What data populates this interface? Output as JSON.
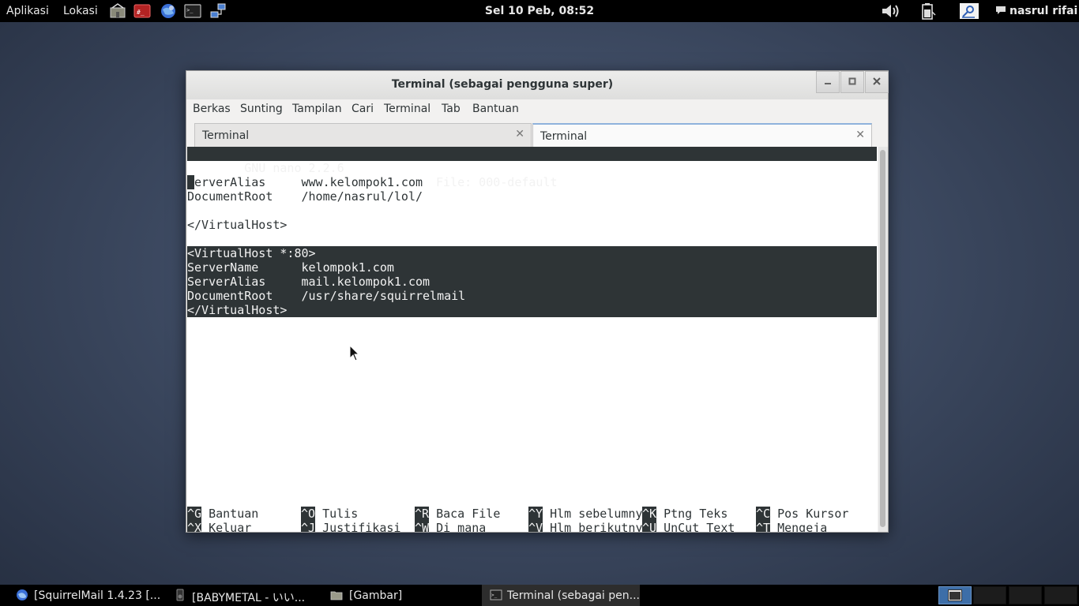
{
  "top_panel": {
    "applications_label": "Aplikasi",
    "places_label": "Lokasi",
    "launchers": [
      "home-folder-icon",
      "terminal-red-icon",
      "browser-globe-icon",
      "terminal-icon",
      "network-icon"
    ],
    "clock": "Sel 10 Peb, 08:52",
    "tray": [
      "volume-icon",
      "battery-icon",
      "power-icon"
    ],
    "user": "nasrul rifai"
  },
  "window": {
    "title": "Terminal (sebagai pengguna super)",
    "controls": [
      "minimize",
      "maximize",
      "close"
    ],
    "menu": [
      "Berkas",
      "Sunting",
      "Tampilan",
      "Cari",
      "Terminal",
      "Tab",
      "Bantuan"
    ],
    "tabs": [
      {
        "label": "Terminal",
        "active": false
      },
      {
        "label": "Terminal",
        "active": true
      }
    ]
  },
  "nano": {
    "header_app": "  GNU nano 2.2.6",
    "header_file": "File: 000-default",
    "lines": [
      "",
      "ServerAlias     www.kelompok1.com",
      "DocumentRoot    /home/nasrul/lol/",
      "",
      "</VirtualHost>",
      "",
      "<VirtualHost *:80>",
      "ServerName      kelompok1.com",
      "ServerAlias     mail.kelompok1.com",
      "DocumentRoot    /usr/share/squirrelmail",
      "</VirtualHost>"
    ],
    "selected_from_line": 6,
    "shortcuts_row1": [
      {
        "key": "^G",
        "label": "Bantuan"
      },
      {
        "key": "^O",
        "label": "Tulis"
      },
      {
        "key": "^R",
        "label": "Baca File"
      },
      {
        "key": "^Y",
        "label": "Hlm sebelumny"
      },
      {
        "key": "^K",
        "label": "Ptng Teks"
      },
      {
        "key": "^C",
        "label": "Pos Kursor"
      }
    ],
    "shortcuts_row2": [
      {
        "key": "^X",
        "label": "Keluar"
      },
      {
        "key": "^J",
        "label": "Justifikasi"
      },
      {
        "key": "^W",
        "label": "Di mana"
      },
      {
        "key": "^V",
        "label": "Hlm berikutny"
      },
      {
        "key": "^U",
        "label": "UnCut Text"
      },
      {
        "key": "^T",
        "label": "Mengeja"
      }
    ]
  },
  "taskbar": {
    "items": [
      {
        "label": "[SquirrelMail 1.4.23 [...",
        "icon": "browser-icon"
      },
      {
        "label": "[BABYMETAL - いい...",
        "icon": "media-player-icon"
      },
      {
        "label": "[Gambar]",
        "icon": "folder-icon"
      },
      {
        "label": "Terminal (sebagai pen...",
        "icon": "terminal-icon",
        "active": true
      }
    ],
    "workspaces": 4,
    "active_workspace": 1
  },
  "colors": {
    "panel": "#000000",
    "terminal_bg": "#ffffff",
    "terminal_fg": "#2e3436",
    "selection": "#2e3436",
    "active_tab_accent": "#4a90d9"
  }
}
